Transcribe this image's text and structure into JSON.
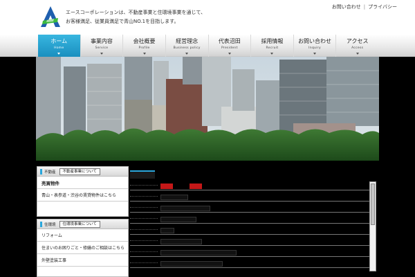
{
  "header": {
    "tagline_line1": "エースコーポレーションは、不動産事業と住環境事業を通じて、",
    "tagline_line2": "お客様満足、従業員満足で青山NO.1を目指します。",
    "top_links": [
      "お問い合わせ",
      "プライバシー"
    ],
    "logo_icon": "ace-logo-icon"
  },
  "nav": {
    "items": [
      {
        "label": "ホーム",
        "sub": "Home",
        "active": true
      },
      {
        "label": "事業内容",
        "sub": "Service"
      },
      {
        "label": "会社概要",
        "sub": "Profile"
      },
      {
        "label": "経営理念",
        "sub": "Business policy"
      },
      {
        "label": "代表沼田",
        "sub": "President"
      },
      {
        "label": "採用情報",
        "sub": "Recruit"
      },
      {
        "label": "お問い合わせ",
        "sub": "Inquiry"
      },
      {
        "label": "アクセス",
        "sub": "Access"
      }
    ]
  },
  "sidebar": {
    "box1": {
      "tag": "不動産",
      "button": "不動産事業について",
      "rows": [
        "売買物件",
        "青山・表参道・渋谷の賃貸物件はこちら"
      ]
    },
    "box2": {
      "tag": "住環境",
      "button": "住環境事業について",
      "rows": [
        "リフォーム",
        "住まいのお困りごと・修繕のご相談はこちら",
        "外壁塗装工事"
      ]
    }
  },
  "colors": {
    "accent": "#2aa7dc",
    "highlight": "#c41818",
    "background": "#000000"
  }
}
